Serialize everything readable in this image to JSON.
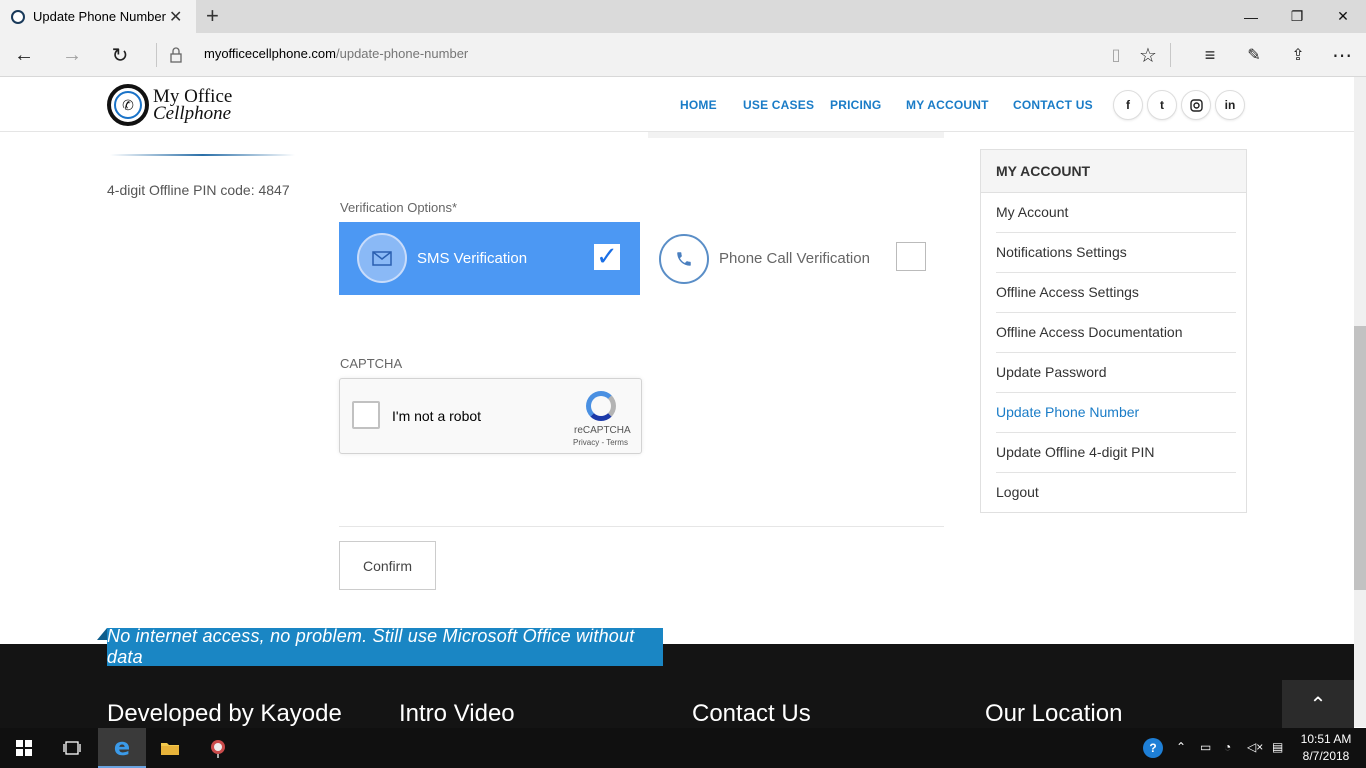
{
  "browser": {
    "tab_title": "Update Phone Number",
    "url_host": "myofficecellphone.com",
    "url_path": "/update-phone-number"
  },
  "site": {
    "logo_line1": "My Office",
    "logo_line2": "Cellphone",
    "nav": [
      "HOME",
      "USE CASES",
      "PRICING",
      "MY ACCOUNT",
      "CONTACT US"
    ],
    "social": [
      "facebook-icon",
      "twitter-icon",
      "instagram-icon",
      "linkedin-icon"
    ]
  },
  "content": {
    "pin_text": "4-digit Offline PIN code: 4847",
    "verification_label": "Verification Options*",
    "sms_label": "SMS Verification",
    "sms_checked": true,
    "call_label": "Phone Call Verification",
    "call_checked": false,
    "captcha_label": "CAPTCHA",
    "recaptcha_text": "I'm not a robot",
    "recaptcha_brand": "reCAPTCHA",
    "recaptcha_links": "Privacy - Terms",
    "confirm_label": "Confirm"
  },
  "sidebar": {
    "title": "MY ACCOUNT",
    "items": [
      {
        "label": "My Account",
        "active": false
      },
      {
        "label": "Notifications Settings",
        "active": false
      },
      {
        "label": "Offline Access Settings",
        "active": false
      },
      {
        "label": "Offline Access Documentation",
        "active": false
      },
      {
        "label": "Update Password",
        "active": false
      },
      {
        "label": "Update Phone Number",
        "active": true
      },
      {
        "label": "Update Offline 4-digit PIN",
        "active": false
      },
      {
        "label": "Logout",
        "active": false
      }
    ]
  },
  "footer": {
    "banner": "No internet access, no problem. Still use Microsoft Office without data",
    "headings": [
      "Developed by Kayode",
      "Intro Video",
      "Contact Us",
      "Our Location"
    ]
  },
  "taskbar": {
    "time": "10:51 AM",
    "date": "8/7/2018"
  },
  "colors": {
    "accent": "#1a7cc7",
    "sms_box": "#4c98f3",
    "footer": "#141414",
    "banner": "#1a86c4"
  }
}
